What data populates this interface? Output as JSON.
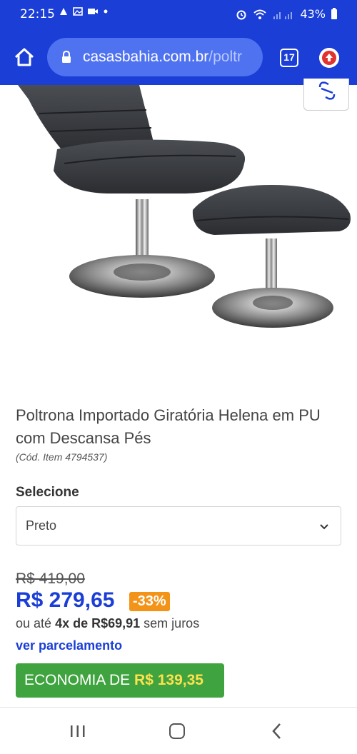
{
  "status_bar": {
    "time": "22:15",
    "battery": "43%"
  },
  "browser": {
    "url_host": "casasbahia.com.br",
    "url_path": "/poltr",
    "tab_count": "17"
  },
  "product": {
    "title": "Poltrona Importado Giratória Helena em PU com Descansa Pés",
    "code": "(Cód. Item 4794537)",
    "select_label": "Selecione",
    "selected_option": "Preto",
    "old_price": "R$ 419,00",
    "price": "R$ 279,65",
    "discount": "-33%",
    "installment_prefix": "ou até",
    "installment_count": "4x de R$69,91",
    "installment_suffix": "sem juros",
    "installment_link": "ver parcelamento",
    "economia_label": "ECONOMIA DE",
    "economia_amount": "R$ 139,35"
  },
  "colors": {
    "brand_blue": "#1a3ed6",
    "discount_orange": "#f39318",
    "economia_green": "#3fa33f",
    "economia_amount_yellow": "#ffe24d"
  },
  "icons": [
    "home-icon",
    "lock-icon",
    "tabs-icon",
    "update-icon",
    "share-icon",
    "chevron-down-icon",
    "recent-apps-icon",
    "nav-home-icon",
    "nav-back-icon"
  ]
}
